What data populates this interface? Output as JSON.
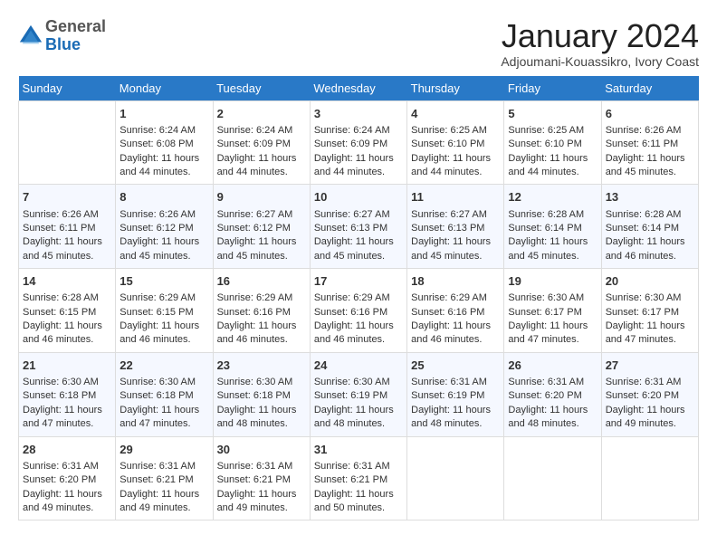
{
  "header": {
    "logo_line1": "General",
    "logo_line2": "Blue",
    "month": "January 2024",
    "location": "Adjoumani-Kouassikro, Ivory Coast"
  },
  "weekdays": [
    "Sunday",
    "Monday",
    "Tuesday",
    "Wednesday",
    "Thursday",
    "Friday",
    "Saturday"
  ],
  "weeks": [
    [
      {
        "day": "",
        "sunrise": "",
        "sunset": "",
        "daylight": ""
      },
      {
        "day": "1",
        "sunrise": "Sunrise: 6:24 AM",
        "sunset": "Sunset: 6:08 PM",
        "daylight": "Daylight: 11 hours and 44 minutes."
      },
      {
        "day": "2",
        "sunrise": "Sunrise: 6:24 AM",
        "sunset": "Sunset: 6:09 PM",
        "daylight": "Daylight: 11 hours and 44 minutes."
      },
      {
        "day": "3",
        "sunrise": "Sunrise: 6:24 AM",
        "sunset": "Sunset: 6:09 PM",
        "daylight": "Daylight: 11 hours and 44 minutes."
      },
      {
        "day": "4",
        "sunrise": "Sunrise: 6:25 AM",
        "sunset": "Sunset: 6:10 PM",
        "daylight": "Daylight: 11 hours and 44 minutes."
      },
      {
        "day": "5",
        "sunrise": "Sunrise: 6:25 AM",
        "sunset": "Sunset: 6:10 PM",
        "daylight": "Daylight: 11 hours and 44 minutes."
      },
      {
        "day": "6",
        "sunrise": "Sunrise: 6:26 AM",
        "sunset": "Sunset: 6:11 PM",
        "daylight": "Daylight: 11 hours and 45 minutes."
      }
    ],
    [
      {
        "day": "7",
        "sunrise": "Sunrise: 6:26 AM",
        "sunset": "Sunset: 6:11 PM",
        "daylight": "Daylight: 11 hours and 45 minutes."
      },
      {
        "day": "8",
        "sunrise": "Sunrise: 6:26 AM",
        "sunset": "Sunset: 6:12 PM",
        "daylight": "Daylight: 11 hours and 45 minutes."
      },
      {
        "day": "9",
        "sunrise": "Sunrise: 6:27 AM",
        "sunset": "Sunset: 6:12 PM",
        "daylight": "Daylight: 11 hours and 45 minutes."
      },
      {
        "day": "10",
        "sunrise": "Sunrise: 6:27 AM",
        "sunset": "Sunset: 6:13 PM",
        "daylight": "Daylight: 11 hours and 45 minutes."
      },
      {
        "day": "11",
        "sunrise": "Sunrise: 6:27 AM",
        "sunset": "Sunset: 6:13 PM",
        "daylight": "Daylight: 11 hours and 45 minutes."
      },
      {
        "day": "12",
        "sunrise": "Sunrise: 6:28 AM",
        "sunset": "Sunset: 6:14 PM",
        "daylight": "Daylight: 11 hours and 45 minutes."
      },
      {
        "day": "13",
        "sunrise": "Sunrise: 6:28 AM",
        "sunset": "Sunset: 6:14 PM",
        "daylight": "Daylight: 11 hours and 46 minutes."
      }
    ],
    [
      {
        "day": "14",
        "sunrise": "Sunrise: 6:28 AM",
        "sunset": "Sunset: 6:15 PM",
        "daylight": "Daylight: 11 hours and 46 minutes."
      },
      {
        "day": "15",
        "sunrise": "Sunrise: 6:29 AM",
        "sunset": "Sunset: 6:15 PM",
        "daylight": "Daylight: 11 hours and 46 minutes."
      },
      {
        "day": "16",
        "sunrise": "Sunrise: 6:29 AM",
        "sunset": "Sunset: 6:16 PM",
        "daylight": "Daylight: 11 hours and 46 minutes."
      },
      {
        "day": "17",
        "sunrise": "Sunrise: 6:29 AM",
        "sunset": "Sunset: 6:16 PM",
        "daylight": "Daylight: 11 hours and 46 minutes."
      },
      {
        "day": "18",
        "sunrise": "Sunrise: 6:29 AM",
        "sunset": "Sunset: 6:16 PM",
        "daylight": "Daylight: 11 hours and 46 minutes."
      },
      {
        "day": "19",
        "sunrise": "Sunrise: 6:30 AM",
        "sunset": "Sunset: 6:17 PM",
        "daylight": "Daylight: 11 hours and 47 minutes."
      },
      {
        "day": "20",
        "sunrise": "Sunrise: 6:30 AM",
        "sunset": "Sunset: 6:17 PM",
        "daylight": "Daylight: 11 hours and 47 minutes."
      }
    ],
    [
      {
        "day": "21",
        "sunrise": "Sunrise: 6:30 AM",
        "sunset": "Sunset: 6:18 PM",
        "daylight": "Daylight: 11 hours and 47 minutes."
      },
      {
        "day": "22",
        "sunrise": "Sunrise: 6:30 AM",
        "sunset": "Sunset: 6:18 PM",
        "daylight": "Daylight: 11 hours and 47 minutes."
      },
      {
        "day": "23",
        "sunrise": "Sunrise: 6:30 AM",
        "sunset": "Sunset: 6:18 PM",
        "daylight": "Daylight: 11 hours and 48 minutes."
      },
      {
        "day": "24",
        "sunrise": "Sunrise: 6:30 AM",
        "sunset": "Sunset: 6:19 PM",
        "daylight": "Daylight: 11 hours and 48 minutes."
      },
      {
        "day": "25",
        "sunrise": "Sunrise: 6:31 AM",
        "sunset": "Sunset: 6:19 PM",
        "daylight": "Daylight: 11 hours and 48 minutes."
      },
      {
        "day": "26",
        "sunrise": "Sunrise: 6:31 AM",
        "sunset": "Sunset: 6:20 PM",
        "daylight": "Daylight: 11 hours and 48 minutes."
      },
      {
        "day": "27",
        "sunrise": "Sunrise: 6:31 AM",
        "sunset": "Sunset: 6:20 PM",
        "daylight": "Daylight: 11 hours and 49 minutes."
      }
    ],
    [
      {
        "day": "28",
        "sunrise": "Sunrise: 6:31 AM",
        "sunset": "Sunset: 6:20 PM",
        "daylight": "Daylight: 11 hours and 49 minutes."
      },
      {
        "day": "29",
        "sunrise": "Sunrise: 6:31 AM",
        "sunset": "Sunset: 6:21 PM",
        "daylight": "Daylight: 11 hours and 49 minutes."
      },
      {
        "day": "30",
        "sunrise": "Sunrise: 6:31 AM",
        "sunset": "Sunset: 6:21 PM",
        "daylight": "Daylight: 11 hours and 49 minutes."
      },
      {
        "day": "31",
        "sunrise": "Sunrise: 6:31 AM",
        "sunset": "Sunset: 6:21 PM",
        "daylight": "Daylight: 11 hours and 50 minutes."
      },
      {
        "day": "",
        "sunrise": "",
        "sunset": "",
        "daylight": ""
      },
      {
        "day": "",
        "sunrise": "",
        "sunset": "",
        "daylight": ""
      },
      {
        "day": "",
        "sunrise": "",
        "sunset": "",
        "daylight": ""
      }
    ]
  ]
}
